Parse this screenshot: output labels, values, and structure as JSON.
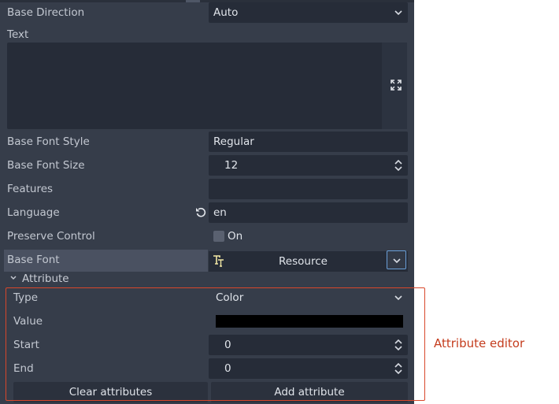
{
  "inspector": {
    "base_direction": {
      "label": "Base Direction",
      "value": "Auto"
    },
    "text": {
      "label": "Text",
      "value": ""
    },
    "base_font_style": {
      "label": "Base Font Style",
      "value": "Regular"
    },
    "base_font_size": {
      "label": "Base Font Size",
      "value": "12"
    },
    "features": {
      "label": "Features",
      "value": ""
    },
    "language": {
      "label": "Language",
      "value": "en"
    },
    "preserve_control": {
      "label": "Preserve Control",
      "value": "On",
      "checked": false
    },
    "base_font": {
      "label": "Base Font",
      "value": "Resource"
    }
  },
  "attribute_section": {
    "title": "Attribute",
    "type": {
      "label": "Type",
      "value": "Color"
    },
    "value": {
      "label": "Value",
      "color": "#000000"
    },
    "start": {
      "label": "Start",
      "value": "0"
    },
    "end": {
      "label": "End",
      "value": "0"
    },
    "clear_button": "Clear attributes",
    "add_button": "Add attribute"
  },
  "annotation": {
    "label": "Attribute editor",
    "color": "#d9472b"
  },
  "colors": {
    "panel": "#363d4a",
    "field": "#262c38",
    "highlight": "#4a5161",
    "focus": "#6a9fd8"
  }
}
